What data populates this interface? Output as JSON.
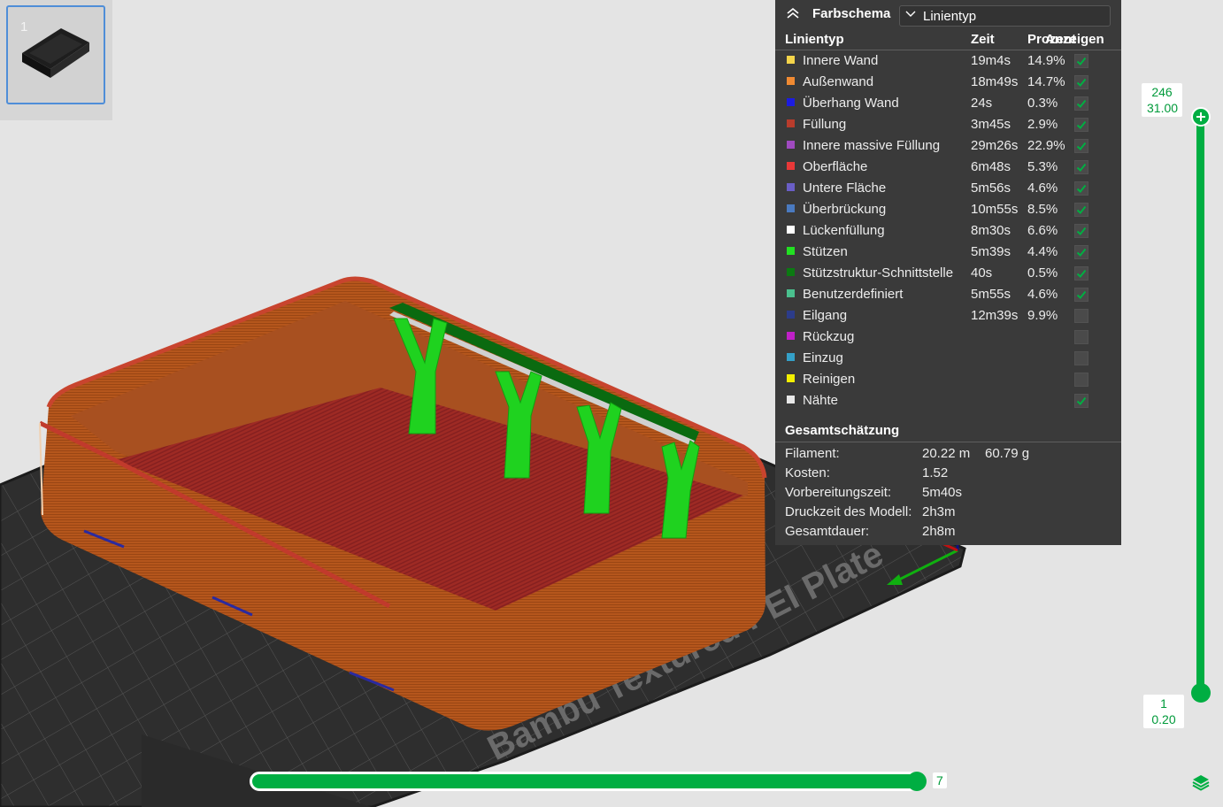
{
  "thumbnail": {
    "plate_number": "1"
  },
  "color_scheme": {
    "label": "Farbschema",
    "selected": "Linientyp"
  },
  "columns": {
    "type": "Linientyp",
    "time": "Zeit",
    "percent": "Prozent",
    "show": "Anzeigen"
  },
  "line_types": [
    {
      "name": "Innere Wand",
      "time": "19m4s",
      "percent": "14.9%",
      "color": "#f4d44a",
      "shown": true
    },
    {
      "name": "Außenwand",
      "time": "18m49s",
      "percent": "14.7%",
      "color": "#f08a32",
      "shown": true
    },
    {
      "name": "Überhang Wand",
      "time": "24s",
      "percent": "0.3%",
      "color": "#1c1ce0",
      "shown": true
    },
    {
      "name": "Füllung",
      "time": "3m45s",
      "percent": "2.9%",
      "color": "#b83c2c",
      "shown": true
    },
    {
      "name": "Innere massive Füllung",
      "time": "29m26s",
      "percent": "22.9%",
      "color": "#a04ac0",
      "shown": true
    },
    {
      "name": "Oberfläche",
      "time": "6m48s",
      "percent": "5.3%",
      "color": "#e83838",
      "shown": true
    },
    {
      "name": "Untere Fläche",
      "time": "5m56s",
      "percent": "4.6%",
      "color": "#6a5ec6",
      "shown": true
    },
    {
      "name": "Überbrückung",
      "time": "10m55s",
      "percent": "8.5%",
      "color": "#4a7ac0",
      "shown": true
    },
    {
      "name": "Lückenfüllung",
      "time": "8m30s",
      "percent": "6.6%",
      "color": "#ffffff",
      "shown": true
    },
    {
      "name": "Stützen",
      "time": "5m39s",
      "percent": "4.4%",
      "color": "#22e022",
      "shown": true
    },
    {
      "name": "Stützstruktur-Schnittstelle",
      "time": "40s",
      "percent": "0.5%",
      "color": "#0c7a12",
      "shown": true
    },
    {
      "name": "Benutzerdefiniert",
      "time": "5m55s",
      "percent": "4.6%",
      "color": "#4ac08e",
      "shown": true
    },
    {
      "name": "Eilgang",
      "time": "12m39s",
      "percent": "9.9%",
      "color": "#2c3c8a",
      "shown": false
    },
    {
      "name": "Rückzug",
      "time": "",
      "percent": "",
      "color": "#c020c8",
      "shown": false
    },
    {
      "name": "Einzug",
      "time": "",
      "percent": "",
      "color": "#34a0c8",
      "shown": false
    },
    {
      "name": "Reinigen",
      "time": "",
      "percent": "",
      "color": "#f4f000",
      "shown": false
    },
    {
      "name": "Nähte",
      "time": "",
      "percent": "",
      "color": "#e8e8e8",
      "shown": true
    }
  ],
  "estimate": {
    "title": "Gesamtschätzung",
    "filament_label": "Filament:",
    "filament_length": "20.22 m",
    "filament_weight": "60.79 g",
    "cost_label": "Kosten:",
    "cost": "1.52",
    "prep_label": "Vorbereitungszeit:",
    "prep": "5m40s",
    "model_time_label": "Druckzeit des Modell:",
    "model_time": "2h3m",
    "total_label": "Gesamtdauer:",
    "total": "2h8m"
  },
  "layer_slider": {
    "top_layer": "246",
    "top_height": "31.00",
    "bottom_layer": "1",
    "bottom_height": "0.20"
  },
  "move_slider": {
    "value": "7"
  },
  "colors": {
    "accent": "#00ae42",
    "panel_bg": "#3a3a3a"
  },
  "plate_text": "Bambu Textured PEI Plate"
}
